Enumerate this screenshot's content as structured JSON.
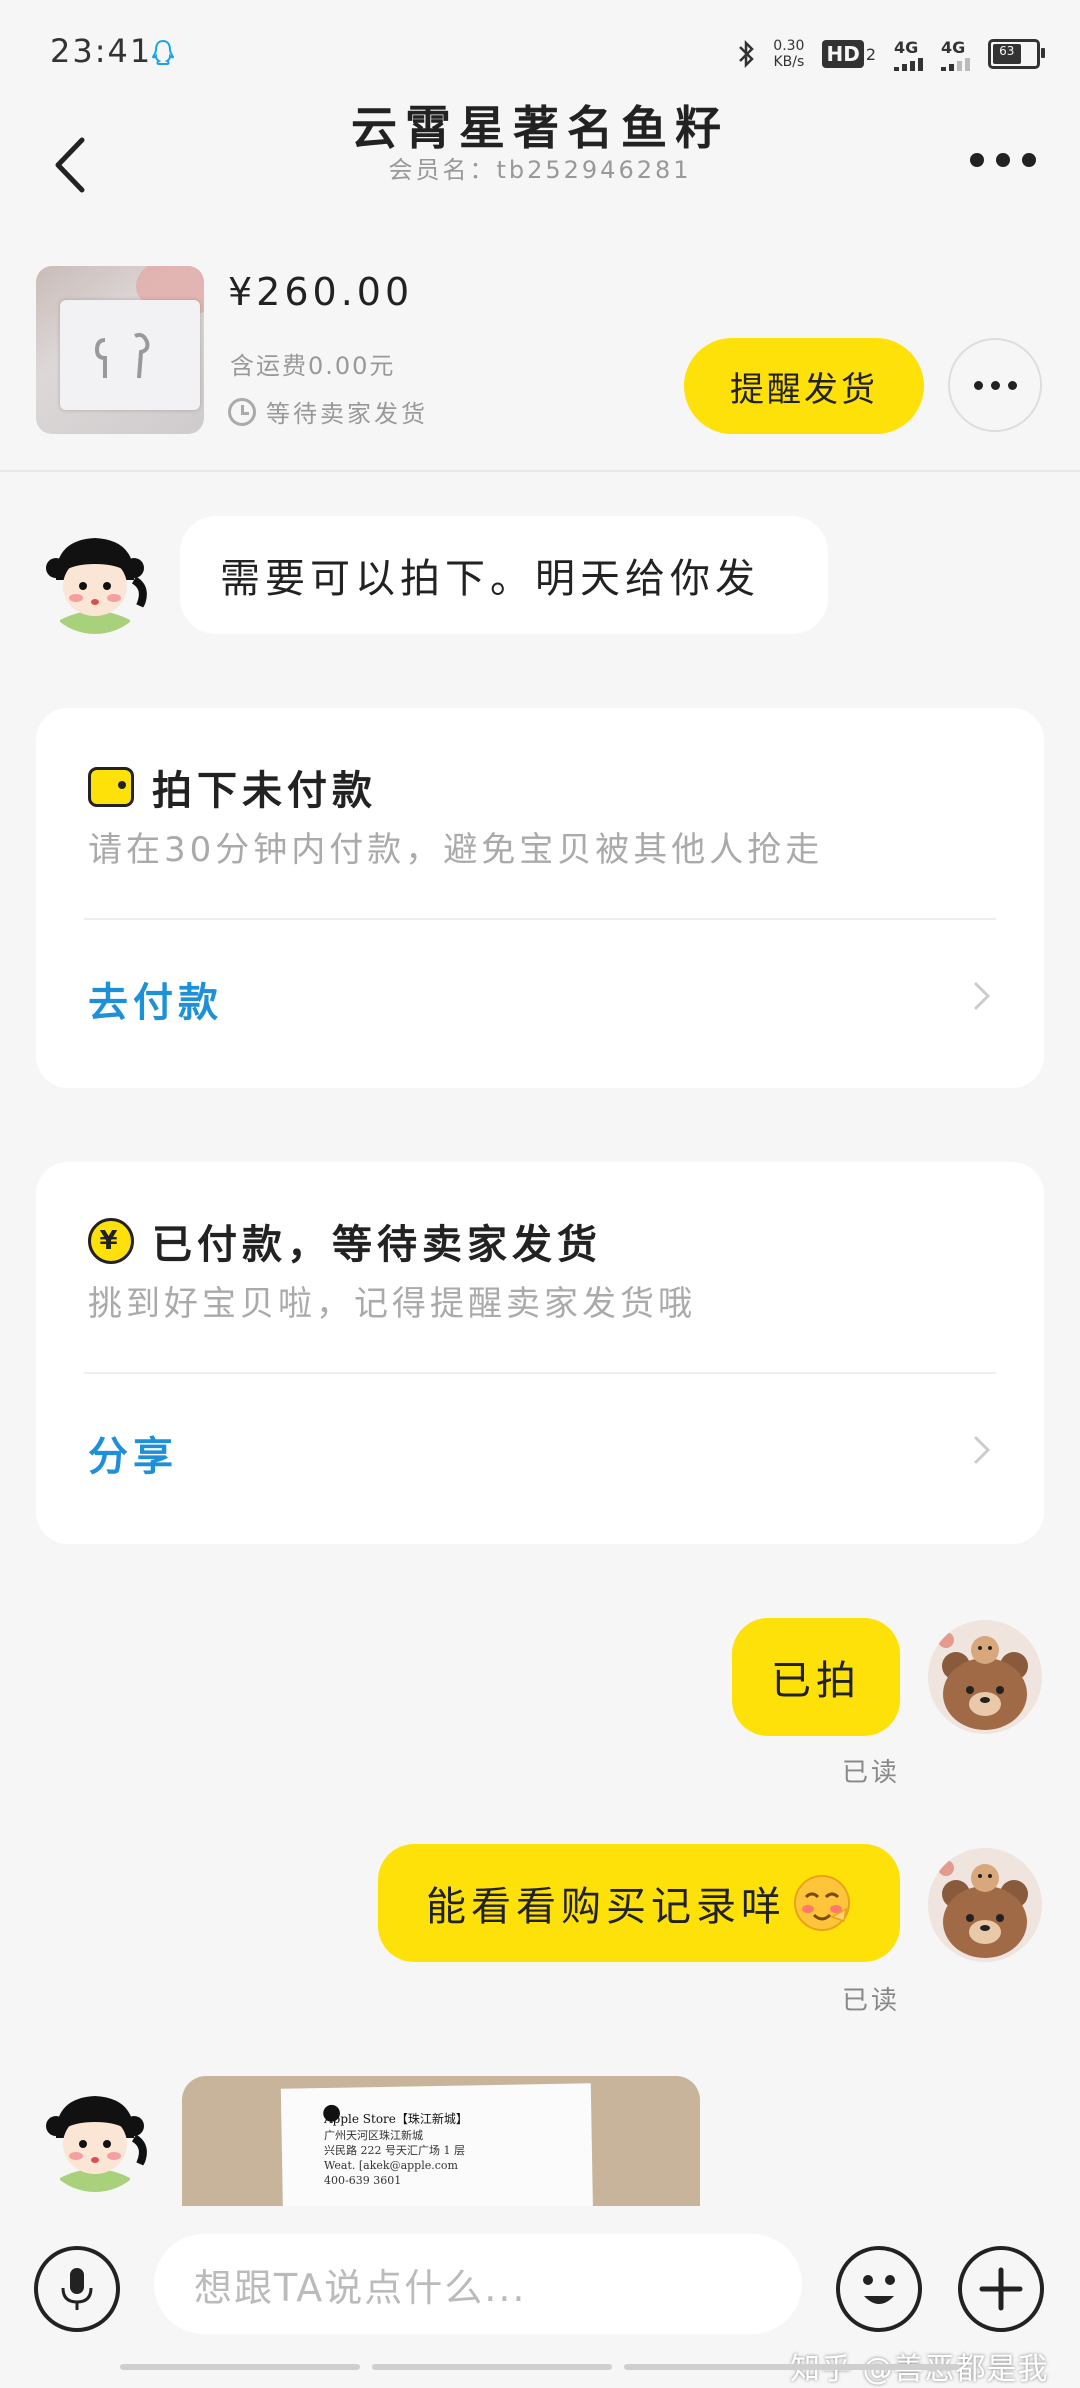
{
  "status_bar": {
    "time": "23:41",
    "net_speed_top": "0.30",
    "net_speed_bottom": "KB/s",
    "hd": "HD",
    "sim_sub": "2",
    "sig1": "4G",
    "sig2": "4G",
    "battery": "63"
  },
  "header": {
    "title": "云霄星著名鱼籽",
    "subtitle": "会员名：tb252946281"
  },
  "product": {
    "price": "¥260.00",
    "shipping": "含运费0.00元",
    "status": "等待卖家发货",
    "remind_button": "提醒发货"
  },
  "messages": {
    "seller_msg": "需要可以拍下。明天给你发",
    "card_unpaid": {
      "title": "拍下未付款",
      "desc": "请在30分钟内付款，避免宝贝被其他人抢走",
      "action": "去付款"
    },
    "card_paid": {
      "title": "已付款，等待卖家发货",
      "desc": "挑到好宝贝啦，记得提醒卖家发货哦",
      "action": "分享"
    },
    "my_msg1": "已拍",
    "read1": "已读",
    "my_msg2": "能看看购买记录咩",
    "read2": "已读",
    "receipt": {
      "store": "Apple Store【珠江新城】",
      "lines": "广州天河区珠江新城\n兴民路 222 号天汇广场 1 层\nWeat. [akek@apple.com\n400-639 3601"
    }
  },
  "input_bar": {
    "placeholder": "想跟TA说点什么...",
    "watermark": "知乎 @善恶都是我"
  },
  "colors": {
    "accent_yellow": "#ffe10a",
    "link_blue": "#1e90d8",
    "background": "#f6f6f6"
  }
}
